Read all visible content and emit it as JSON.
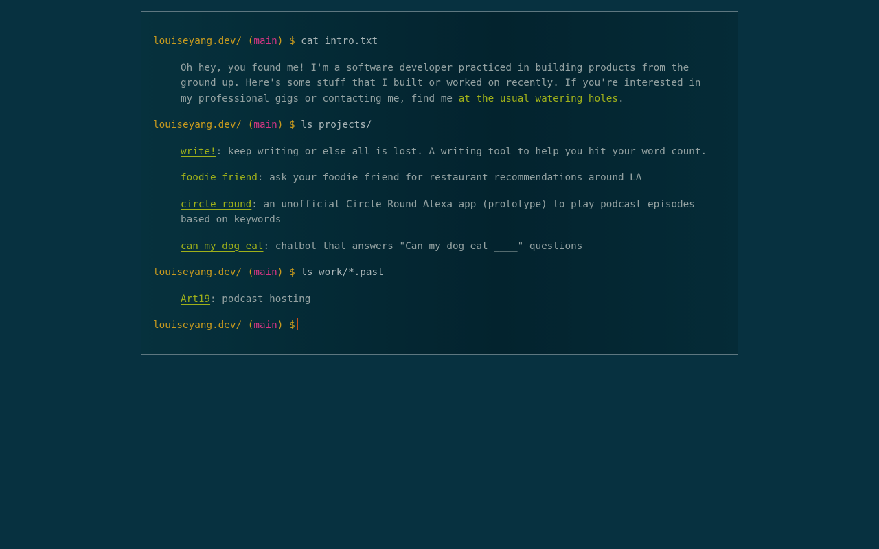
{
  "prompt": {
    "host": "louiseyang.dev/",
    "branch": "main",
    "symbol": "$"
  },
  "blocks": [
    {
      "command": "cat intro.txt",
      "intro": {
        "text_before": "Oh hey, you found me! I'm a software developer practiced in building products from the ground up. Here's some stuff that I built or worked on recently. If you're interested in my professional gigs or contacting me, find me ",
        "link": "at the usual watering holes",
        "text_after": "."
      }
    },
    {
      "command": "ls projects/",
      "items": [
        {
          "link": "write!",
          "desc": ": keep writing or else all is lost. A writing tool to help you hit your word count."
        },
        {
          "link": "foodie friend",
          "desc": ": ask your foodie friend for restaurant recommendations around LA"
        },
        {
          "link": "circle round",
          "desc": ": an unofficial Circle Round Alexa app (prototype) to play podcast episodes based on keywords"
        },
        {
          "link": "can my dog eat",
          "desc": ": chatbot that answers \"Can my dog eat ____\" questions"
        }
      ]
    },
    {
      "command": "ls work/*.past",
      "items": [
        {
          "link": "Art19",
          "desc": ": podcast hosting"
        }
      ]
    }
  ],
  "colors": {
    "background": "#073140",
    "prompt": "#c89a1e",
    "branch": "#d33682",
    "link": "#9fb01a",
    "text": "#93a1a1",
    "cursor": "#c84f1a"
  }
}
